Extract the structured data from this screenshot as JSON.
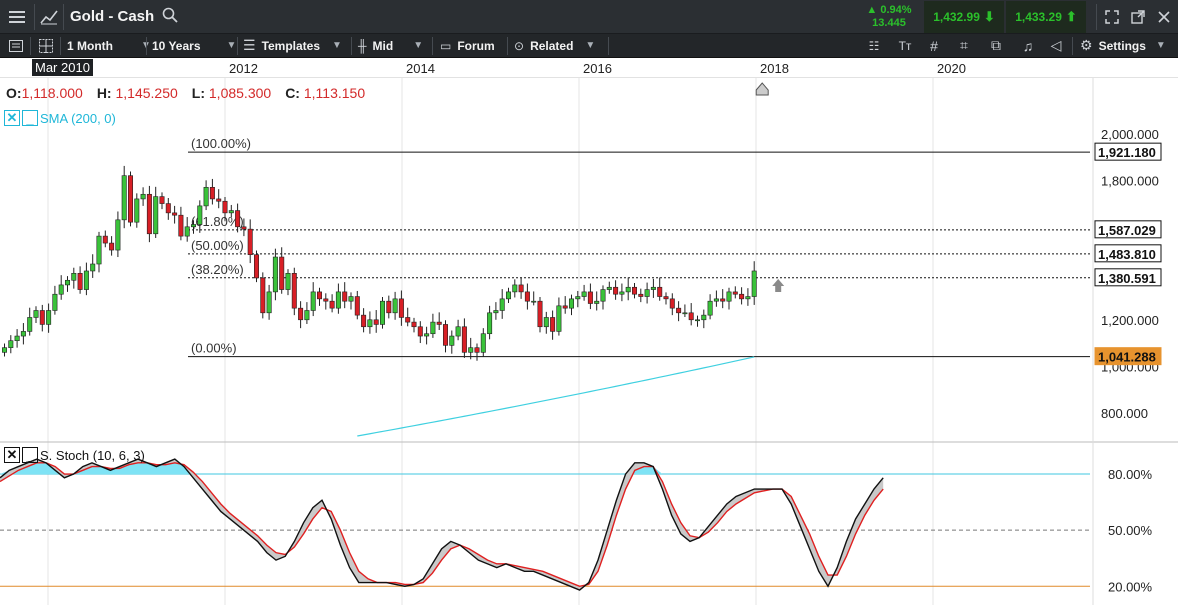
{
  "topbar": {
    "menu_icon": "hamburger-icon",
    "chart_icon": "line-chart-icon",
    "title": "Gold - Cash",
    "search_icon": "search-icon",
    "change_pct": "▲ 0.94%",
    "change_abs": "13.445",
    "sell_price": "1,432.99",
    "buy_price": "1,433.29",
    "colors": {
      "up": "#2bc02b",
      "sell_bg": "#1f2e1f",
      "buy_bg": "#1f2e1f"
    }
  },
  "toolbar": {
    "interval": "1 Month",
    "range": "10 Years",
    "templates": "Templates",
    "price_type": "Mid",
    "forum": "Forum",
    "related": "Related",
    "settings": "Settings"
  },
  "time_axis": {
    "current_label": "Mar 2010",
    "years": [
      "2012",
      "2014",
      "2016",
      "2018",
      "2020"
    ]
  },
  "ohlc": {
    "o_label": "O:",
    "o": "1,118.000",
    "h_label": "H:",
    "h": "1,145.250",
    "l_label": "L:",
    "l": "1,085.300",
    "c_label": "C:",
    "c": "1,113.150"
  },
  "indicators": {
    "sma_label": "SMA (200, 0)",
    "stoch_label": "S. Stoch (10, 6, 3)"
  },
  "chart_data": [
    {
      "type": "candlestick",
      "title": "Gold - Cash",
      "x_unit": "month",
      "x_start": "2010-01",
      "ylim": [
        700,
        2180
      ],
      "y_ticks": [
        800,
        1000,
        1200,
        1800,
        2000
      ],
      "y_tick_labels": [
        "800.000",
        "1,000.000",
        "1,200.000",
        "1,800.000",
        "2,000.000"
      ],
      "close": [
        1080,
        1110,
        1130,
        1150,
        1210,
        1240,
        1180,
        1240,
        1310,
        1350,
        1370,
        1400,
        1330,
        1410,
        1440,
        1560,
        1530,
        1500,
        1630,
        1820,
        1620,
        1720,
        1740,
        1570,
        1730,
        1700,
        1660,
        1650,
        1560,
        1600,
        1610,
        1690,
        1770,
        1720,
        1710,
        1660,
        1670,
        1600,
        1590,
        1480,
        1380,
        1230,
        1320,
        1470,
        1330,
        1400,
        1250,
        1200,
        1240,
        1320,
        1290,
        1280,
        1250,
        1320,
        1280,
        1300,
        1220,
        1170,
        1200,
        1180,
        1280,
        1230,
        1290,
        1210,
        1190,
        1170,
        1130,
        1140,
        1190,
        1180,
        1090,
        1130,
        1170,
        1060,
        1080,
        1060,
        1140,
        1230,
        1240,
        1290,
        1320,
        1350,
        1320,
        1280,
        1280,
        1170,
        1210,
        1150,
        1260,
        1250,
        1290,
        1300,
        1320,
        1270,
        1280,
        1330,
        1340,
        1310,
        1320,
        1340,
        1310,
        1300,
        1330,
        1340,
        1300,
        1290,
        1250,
        1230,
        1230,
        1200,
        1200,
        1220,
        1280,
        1290,
        1280,
        1320,
        1310,
        1290,
        1300,
        1410
      ],
      "sma": {
        "label": "SMA (200, 0)",
        "color": "#3fd0e0",
        "start_index": 56,
        "start_value": 700,
        "end_value": 1040
      },
      "fibonacci": [
        {
          "label": "(100.00%)",
          "value": 1921.18,
          "price_label": "1,921.180"
        },
        {
          "label": "(61.80%)",
          "value": 1587.029,
          "price_label": "1,587.029"
        },
        {
          "label": "(50.00%)",
          "value": 1483.81,
          "price_label": "1,483.810"
        },
        {
          "label": "(38.20%)",
          "value": 1380.591,
          "price_label": "1,380.591"
        },
        {
          "label": "(0.00%)",
          "value": 1041.288,
          "price_label": "1,041.288"
        }
      ]
    },
    {
      "type": "line",
      "title": "S. Stoch (10, 6, 3)",
      "ylim": [
        10,
        95
      ],
      "y_ticks": [
        20,
        50,
        80
      ],
      "y_tick_labels": [
        "20.00%",
        "50.00%",
        "80.00%"
      ],
      "series": [
        {
          "name": "%K",
          "color": "#111111",
          "values": [
            78,
            82,
            84,
            86,
            88,
            86,
            82,
            78,
            80,
            84,
            86,
            84,
            82,
            84,
            86,
            88,
            86,
            84,
            86,
            88,
            84,
            78,
            72,
            66,
            60,
            56,
            52,
            48,
            44,
            38,
            34,
            36,
            44,
            54,
            62,
            66,
            56,
            42,
            30,
            22,
            22,
            22,
            22,
            21,
            20,
            21,
            24,
            32,
            40,
            44,
            42,
            38,
            34,
            32,
            30,
            32,
            30,
            28,
            28,
            26,
            24,
            22,
            20,
            18,
            22,
            34,
            50,
            66,
            80,
            86,
            86,
            84,
            72,
            58,
            48,
            44,
            46,
            52,
            58,
            64,
            68,
            70,
            72,
            72,
            72,
            72,
            64,
            52,
            40,
            28,
            20,
            30,
            44,
            56,
            64,
            72,
            78
          ]
        },
        {
          "name": "%D",
          "color": "#e02020",
          "values": [
            76,
            79,
            82,
            84,
            86,
            86,
            84,
            80,
            80,
            82,
            84,
            84,
            83,
            83,
            85,
            86,
            86,
            85,
            85,
            86,
            85,
            81,
            76,
            70,
            64,
            59,
            55,
            51,
            47,
            42,
            38,
            37,
            41,
            48,
            56,
            62,
            60,
            50,
            38,
            28,
            24,
            22,
            22,
            22,
            21,
            21,
            22,
            27,
            34,
            40,
            42,
            40,
            37,
            34,
            32,
            32,
            31,
            30,
            29,
            28,
            26,
            24,
            22,
            20,
            21,
            28,
            42,
            58,
            72,
            82,
            84,
            84,
            76,
            64,
            54,
            47,
            46,
            49,
            54,
            60,
            64,
            67,
            70,
            71,
            72,
            72,
            68,
            58,
            48,
            36,
            26,
            26,
            36,
            48,
            58,
            66,
            72
          ]
        }
      ],
      "levels": [
        {
          "value": 80,
          "color": "#3fc7e0"
        },
        {
          "value": 50,
          "color": "#777777"
        },
        {
          "value": 20,
          "color": "#e08a2a"
        }
      ],
      "overbought_fill": "#7fe3f5"
    }
  ]
}
